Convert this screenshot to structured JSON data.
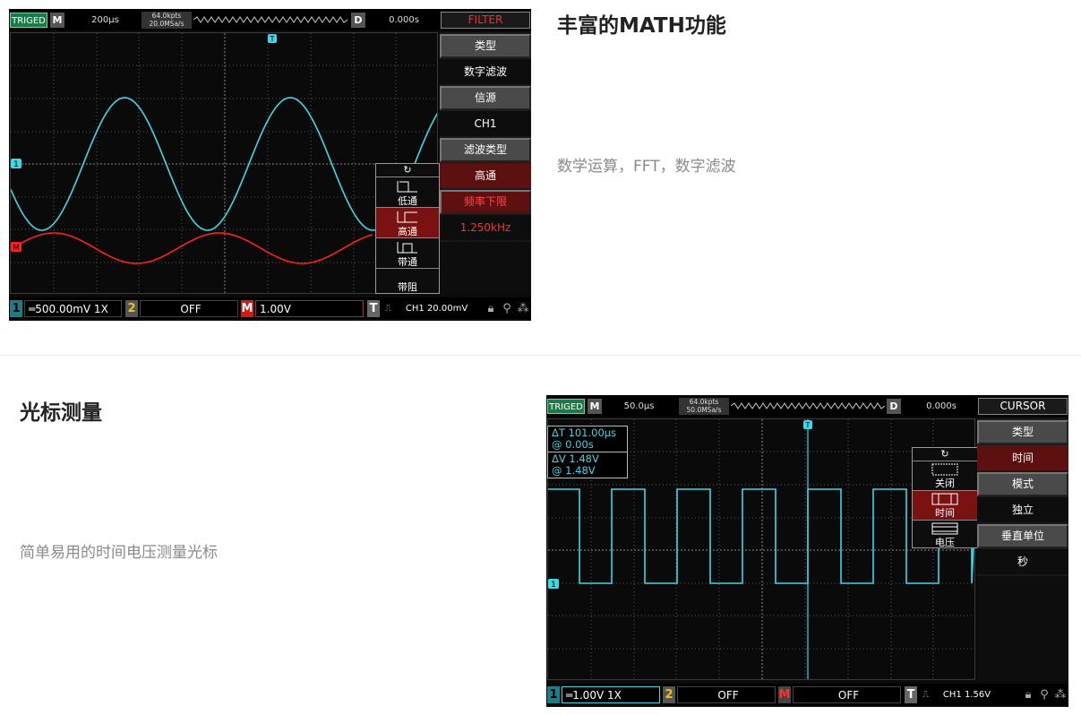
{
  "section1": {
    "heading": "丰富的MATH功能",
    "description": "数学运算，FFT，数字滤波"
  },
  "section2": {
    "heading": "光标测量",
    "description": "简单易用的时间电压测量光标"
  },
  "scope1": {
    "trig_status": "TRIGED",
    "m_badge": "M",
    "timebase": "200μs",
    "mem_depth": "64.0kpts",
    "sample_rate": "20.0MSa/s",
    "d_badge": "D",
    "trig_delay": "0.000s",
    "menu_title": "FILTER",
    "side_menu": {
      "type_label": "类型",
      "type_value": "数字滤波",
      "source_label": "信源",
      "source_value": "CH1",
      "filter_type_label": "滤波类型",
      "filter_type_value": "高通",
      "freq_lower_label": "频率下限",
      "freq_lower_value": "1.250kHz"
    },
    "popup": {
      "refresh_glyph": "↻",
      "options": [
        "低通",
        "高通",
        "带通",
        "带阻"
      ],
      "selected": "高通"
    },
    "markers": {
      "ch1": "1",
      "math": "M",
      "trigger": "T"
    },
    "bottom": {
      "ch1_num": "1",
      "ch1_scale": "500.00mV  1X",
      "ch2_num": "2",
      "ch2_state": "OFF",
      "math_badge": "M",
      "math_scale": "1.00V",
      "trig_badge": "T",
      "trig_info": "CH1  20.00mV"
    },
    "colors": {
      "ch1": "#3fd6e6",
      "math": "#ff1f1f",
      "menu_title": "#ff2a2a"
    }
  },
  "scope2": {
    "trig_status": "TRIGED",
    "m_badge": "M",
    "timebase": "50.0μs",
    "mem_depth": "64.0kpts",
    "sample_rate": "50.0MSa/s",
    "d_badge": "D",
    "trig_delay": "0.000s",
    "menu_title": "CURSOR",
    "side_menu": {
      "type_label": "类型",
      "type_value": "时间",
      "mode_label": "模式",
      "mode_value": "独立",
      "vunit_label": "垂直单位",
      "vunit_value": "秒"
    },
    "readout": {
      "delta_t": "ΔT  101.00μs",
      "at_t": "@  0.00s",
      "delta_v": "ΔV  1.48V",
      "at_v": "@  1.48V"
    },
    "popup": {
      "refresh_glyph": "↻",
      "options": [
        "关闭",
        "时间",
        "电压"
      ],
      "selected": "时间"
    },
    "markers": {
      "ch1": "1",
      "trigger": "T"
    },
    "bottom": {
      "ch1_num": "1",
      "ch1_scale": "1.00V  1X",
      "ch2_num": "2",
      "ch2_state": "OFF",
      "math_badge": "M",
      "math_state": "OFF",
      "trig_badge": "T",
      "trig_info": "CH1  1.56V"
    },
    "colors": {
      "ch1": "#3fd6e6"
    }
  }
}
